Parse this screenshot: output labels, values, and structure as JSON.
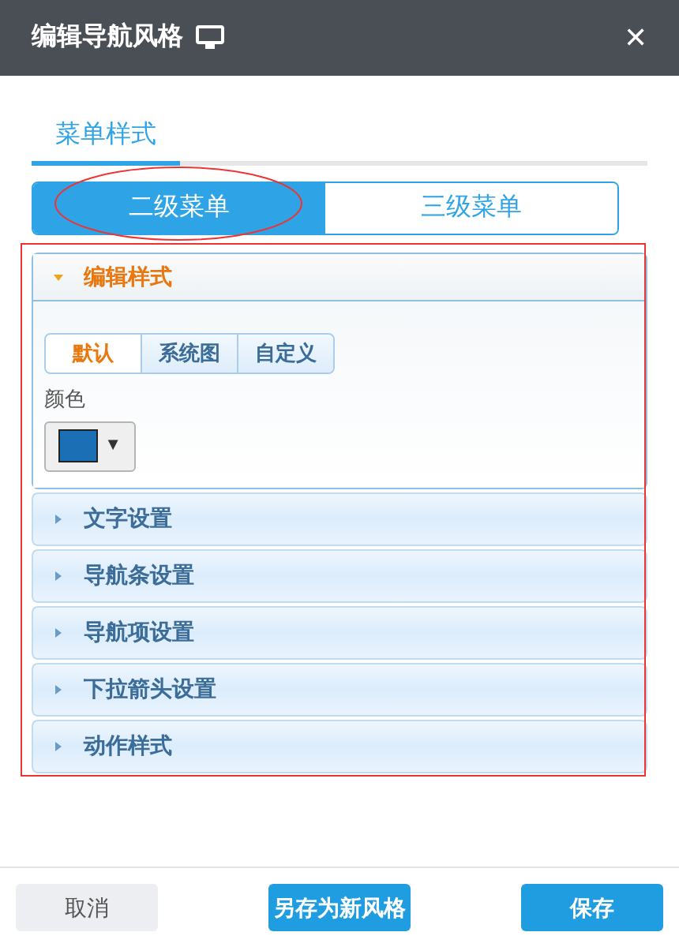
{
  "window": {
    "title": "编辑导航风格",
    "close": "✕"
  },
  "tabs": [
    {
      "label": "菜单样式",
      "selected": true
    }
  ],
  "menu_levels": [
    {
      "label": "二级菜单",
      "selected": true
    },
    {
      "label": "三级菜单",
      "selected": false
    }
  ],
  "sections": [
    {
      "label": "编辑样式",
      "expanded": true,
      "style_tabs": [
        {
          "label": "默认",
          "selected": true
        },
        {
          "label": "系统图",
          "selected": false
        },
        {
          "label": "自定义",
          "selected": false
        }
      ],
      "color_label": "颜色",
      "color_picker": {
        "color": "#1a6fb5",
        "caret": "▼"
      }
    },
    {
      "label": "文字设置",
      "expanded": false
    },
    {
      "label": "导航条设置",
      "expanded": false
    },
    {
      "label": "导航项设置",
      "expanded": false
    },
    {
      "label": "下拉箭头设置",
      "expanded": false
    },
    {
      "label": "动作样式",
      "expanded": false
    }
  ],
  "buttons": [
    {
      "label": "取消",
      "kind": "secondary"
    },
    {
      "label": "另存为新风格",
      "kind": "primary"
    },
    {
      "label": "保存",
      "kind": "primary"
    }
  ]
}
